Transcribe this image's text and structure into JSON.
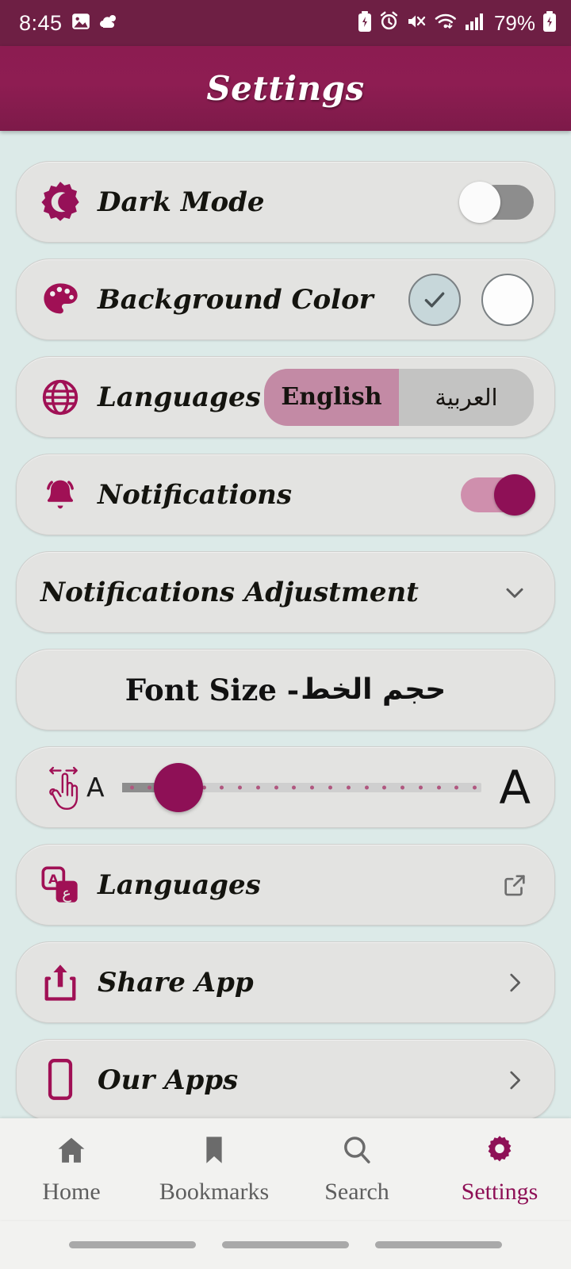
{
  "status_bar": {
    "time": "8:45",
    "battery_percent": "79%",
    "left_icons": [
      "photo-icon",
      "weather-cloud-icon"
    ],
    "right_icons": [
      "battery-saver-icon",
      "alarm-icon",
      "mute-icon",
      "wifi-icon",
      "signal-bars-icon",
      "charging-battery-icon"
    ]
  },
  "app_bar": {
    "title": "Settings"
  },
  "theme": {
    "brand": "#8e1056",
    "app_bar_bg": "#8c1c51",
    "status_bar_bg": "#6e1f44",
    "page_bg": "#dceae8",
    "card_bg": "#e3e3e1"
  },
  "rows": {
    "dark_mode": {
      "label": "Dark Mode",
      "icon": "moon-icon",
      "toggle_state": "off"
    },
    "background_color": {
      "label": "Background Color",
      "icon": "palette-icon",
      "swatches": [
        {
          "name": "mint",
          "color": "#c7d7da",
          "selected": true
        },
        {
          "name": "white",
          "color": "#fdfdfd",
          "selected": false
        }
      ]
    },
    "languages_toggle": {
      "label": "Languages",
      "icon": "globe-icon",
      "options": [
        "English",
        "العربية"
      ],
      "selected": "English"
    },
    "notifications": {
      "label": "Notifications",
      "icon": "bell-icon",
      "toggle_state": "on"
    },
    "notifications_adjustment": {
      "label": "Notifications Adjustment",
      "icon": "chevron-down-icon"
    },
    "font_size_header": {
      "label_en": "Font Size - ",
      "label_ar": "حجم الخط"
    },
    "font_size_slider": {
      "icon": "swipe-hand-icon",
      "small_label": "A",
      "large_label": "A",
      "value_percent": 12
    },
    "languages_link": {
      "label": "Languages",
      "icon": "translate-icon",
      "trailing_icon": "external-link-icon"
    },
    "share_app": {
      "label": "Share App",
      "icon": "share-icon",
      "trailing_icon": "chevron-right-icon"
    },
    "our_apps": {
      "label": "Our Apps",
      "icon": "phone-app-icon",
      "trailing_icon": "chevron-right-icon"
    }
  },
  "bottom_nav": {
    "items": [
      {
        "label": "Home",
        "icon": "home-icon",
        "active": false
      },
      {
        "label": "Bookmarks",
        "icon": "bookmark-icon",
        "active": false
      },
      {
        "label": "Search",
        "icon": "search-icon",
        "active": false
      },
      {
        "label": "Settings",
        "icon": "gear-icon",
        "active": true
      }
    ]
  }
}
